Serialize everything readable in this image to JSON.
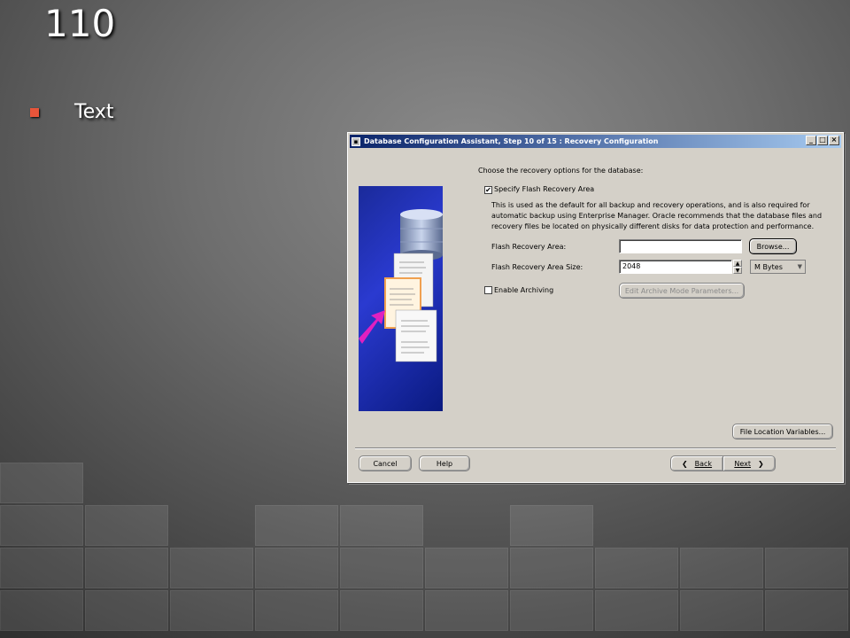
{
  "slide": {
    "title": "110",
    "bullet": "Text"
  },
  "window": {
    "title": "Database Configuration Assistant, Step 10 of 15 : Recovery Configuration",
    "title_buttons": {
      "minimize": "_",
      "maximize": "□",
      "close": "×"
    },
    "intro": "Choose the recovery options for the database:",
    "specify_flash_label": "Specify Flash Recovery Area",
    "specify_flash_checked": true,
    "description": [
      "This is used as the default for all backup and recovery operations, and is also required for",
      "automatic backup using Enterprise Manager. Oracle recommends that the database files and",
      "recovery files be located on physically different disks for data protection and performance."
    ],
    "flash_area_label": "Flash Recovery Area:",
    "flash_area_value": "",
    "browse_label": "Browse...",
    "flash_size_label": "Flash Recovery Area Size:",
    "flash_size_value": "2048",
    "size_unit": "M Bytes",
    "enable_archiving_label": "Enable Archiving",
    "enable_archiving_checked": false,
    "edit_archive_label": "Edit Archive Mode Parameters...",
    "file_location_label": "File Location Variables...",
    "cancel_label": "Cancel",
    "help_label": "Help",
    "back_label": "Back",
    "next_label": "Next"
  },
  "colors": {
    "bullet": "#e8553a",
    "titlebar_start": "#0a246a",
    "dialog_bg": "#d4d0c8",
    "illustration_blue": "#2a3ad0",
    "arrow_magenta": "#e020c0"
  }
}
